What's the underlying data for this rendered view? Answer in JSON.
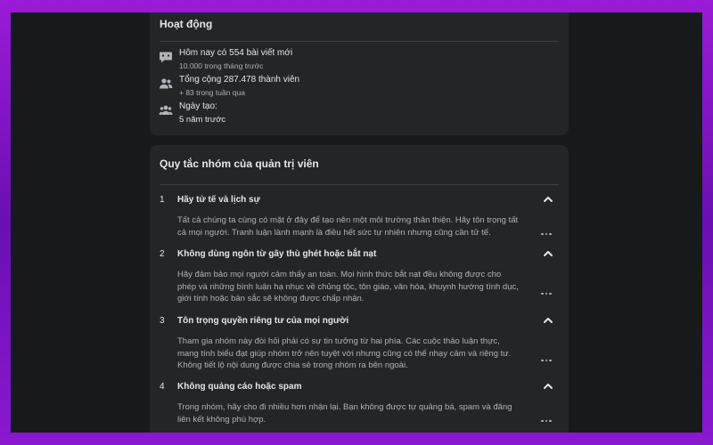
{
  "activity": {
    "title": "Hoạt động",
    "items": [
      {
        "icon": "chat-bubble-icon",
        "main": "Hôm nay có 554 bài viết mới",
        "sub": "10.000 trong tháng trước"
      },
      {
        "icon": "members-icon",
        "main": "Tổng cộng 287.478 thành viên",
        "sub": "+ 83 trong tuần qua"
      },
      {
        "icon": "group-icon",
        "main": "Ngày tạo:",
        "sub": "5 năm trước"
      }
    ]
  },
  "rules": {
    "title": "Quy tắc nhóm của quản trị viên",
    "items": [
      {
        "num": "1",
        "title": "Hãy tử tế và lịch sự",
        "desc": "Tất cả chúng ta cùng có mặt ở đây để tạo nên một môi trường thân thiện. Hãy tôn trọng tất cả mọi người. Tranh luận lành mạnh là điều hết sức tự nhiên nhưng cũng cần tử tế."
      },
      {
        "num": "2",
        "title": "Không dùng ngôn từ gây thù ghét hoặc bắt nạt",
        "desc": "Hãy đảm bảo mọi người cảm thấy an toàn. Mọi hình thức bắt nạt đều không được cho phép và những bình luận hạ nhục về chủng tộc, tôn giáo, văn hóa, khuynh hướng tình dục, giới tính hoặc bản sắc sẽ không được chấp nhận."
      },
      {
        "num": "3",
        "title": "Tôn trọng quyền riêng tư của mọi người",
        "desc": "Tham gia nhóm này đòi hỏi phải có sự tin tưởng từ hai phía. Các cuộc thảo luận thực, mang tính biểu đạt giúp nhóm trở nên tuyệt vời nhưng cũng có thể nhạy cảm và riêng tư. Không tiết lộ nội dung được chia sẻ trong nhóm ra bên ngoài."
      },
      {
        "num": "4",
        "title": "Không quảng cáo hoặc spam",
        "desc": "Trong nhóm, hãy cho đi nhiều hơn nhận lại. Bạn không được tự quảng bá, spam và đăng liên kết không phù hợp."
      }
    ]
  },
  "colors": {
    "background": "#18191a",
    "card": "#242526",
    "text": "#e4e6eb",
    "muted": "#b0b3b8",
    "frame": "#8a18d0"
  }
}
